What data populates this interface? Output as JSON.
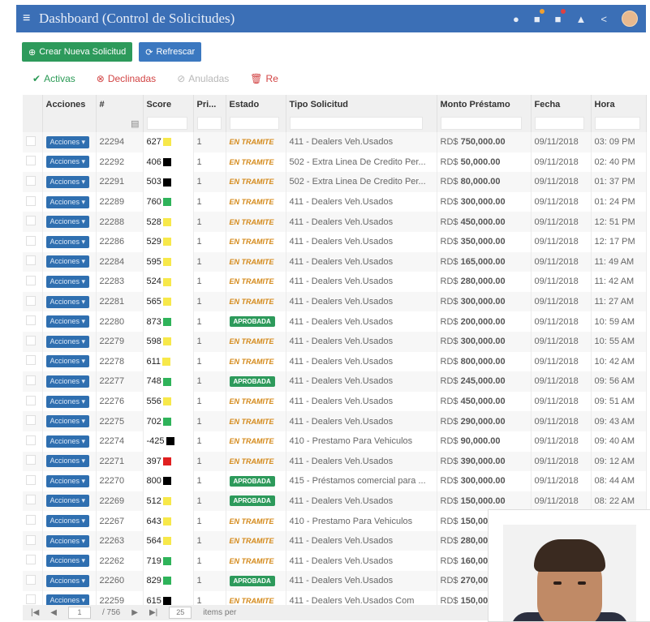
{
  "header": {
    "title": "Dashboard (Control de Solicitudes)"
  },
  "toolbar": {
    "create_label": "Crear Nueva Solicitud",
    "refresh_label": "Refrescar"
  },
  "filters": {
    "activas": "Activas",
    "declinadas": "Declinadas",
    "anuladas": "Anuladas",
    "re": "Re"
  },
  "columns": [
    "Acciones",
    "#",
    "Score",
    "Pri...",
    "Estado",
    "Tipo Solicitud",
    "Monto Préstamo",
    "Fecha",
    "Hora"
  ],
  "acciones_label": "Acciones ▾",
  "rows": [
    {
      "id": "22294",
      "score": "627",
      "color": "#f7e84a",
      "pri": "1",
      "estado": "EN TRAMITE",
      "tipo": "411 - Dealers Veh.Usados",
      "monto": "750,000.00",
      "fecha": "09/11/2018",
      "hora": "03: 09 PM"
    },
    {
      "id": "22292",
      "score": "406",
      "color": "#000000",
      "pri": "1",
      "estado": "EN TRAMITE",
      "tipo": "502 - Extra Linea De Credito Per...",
      "monto": "50,000.00",
      "fecha": "09/11/2018",
      "hora": "02: 40 PM"
    },
    {
      "id": "22291",
      "score": "503",
      "color": "#000000",
      "pri": "1",
      "estado": "EN TRAMITE",
      "tipo": "502 - Extra Linea De Credito Per...",
      "monto": "80,000.00",
      "fecha": "09/11/2018",
      "hora": "01: 37 PM"
    },
    {
      "id": "22289",
      "score": "760",
      "color": "#2fb35a",
      "pri": "1",
      "estado": "EN TRAMITE",
      "tipo": "411 - Dealers Veh.Usados",
      "monto": "300,000.00",
      "fecha": "09/11/2018",
      "hora": "01: 24 PM"
    },
    {
      "id": "22288",
      "score": "528",
      "color": "#f7e84a",
      "pri": "1",
      "estado": "EN TRAMITE",
      "tipo": "411 - Dealers Veh.Usados",
      "monto": "450,000.00",
      "fecha": "09/11/2018",
      "hora": "12: 51 PM"
    },
    {
      "id": "22286",
      "score": "529",
      "color": "#f7e84a",
      "pri": "1",
      "estado": "EN TRAMITE",
      "tipo": "411 - Dealers Veh.Usados",
      "monto": "350,000.00",
      "fecha": "09/11/2018",
      "hora": "12: 17 PM"
    },
    {
      "id": "22284",
      "score": "595",
      "color": "#f7e84a",
      "pri": "1",
      "estado": "EN TRAMITE",
      "tipo": "411 - Dealers Veh.Usados",
      "monto": "165,000.00",
      "fecha": "09/11/2018",
      "hora": "11: 49 AM"
    },
    {
      "id": "22283",
      "score": "524",
      "color": "#f7e84a",
      "pri": "1",
      "estado": "EN TRAMITE",
      "tipo": "411 - Dealers Veh.Usados",
      "monto": "280,000.00",
      "fecha": "09/11/2018",
      "hora": "11: 42 AM"
    },
    {
      "id": "22281",
      "score": "565",
      "color": "#f7e84a",
      "pri": "1",
      "estado": "EN TRAMITE",
      "tipo": "411 - Dealers Veh.Usados",
      "monto": "300,000.00",
      "fecha": "09/11/2018",
      "hora": "11: 27 AM"
    },
    {
      "id": "22280",
      "score": "873",
      "color": "#2fb35a",
      "pri": "1",
      "estado": "APROBADA",
      "tipo": "411 - Dealers Veh.Usados",
      "monto": "200,000.00",
      "fecha": "09/11/2018",
      "hora": "10: 59 AM"
    },
    {
      "id": "22279",
      "score": "598",
      "color": "#f7e84a",
      "pri": "1",
      "estado": "EN TRAMITE",
      "tipo": "411 - Dealers Veh.Usados",
      "monto": "300,000.00",
      "fecha": "09/11/2018",
      "hora": "10: 55 AM"
    },
    {
      "id": "22278",
      "score": "611",
      "color": "#f7e84a",
      "pri": "1",
      "estado": "EN TRAMITE",
      "tipo": "411 - Dealers Veh.Usados",
      "monto": "800,000.00",
      "fecha": "09/11/2018",
      "hora": "10: 42 AM"
    },
    {
      "id": "22277",
      "score": "748",
      "color": "#2fb35a",
      "pri": "1",
      "estado": "APROBADA",
      "tipo": "411 - Dealers Veh.Usados",
      "monto": "245,000.00",
      "fecha": "09/11/2018",
      "hora": "09: 56 AM"
    },
    {
      "id": "22276",
      "score": "556",
      "color": "#f7e84a",
      "pri": "1",
      "estado": "EN TRAMITE",
      "tipo": "411 - Dealers Veh.Usados",
      "monto": "450,000.00",
      "fecha": "09/11/2018",
      "hora": "09: 51 AM"
    },
    {
      "id": "22275",
      "score": "702",
      "color": "#2fb35a",
      "pri": "1",
      "estado": "EN TRAMITE",
      "tipo": "411 - Dealers Veh.Usados",
      "monto": "290,000.00",
      "fecha": "09/11/2018",
      "hora": "09: 43 AM"
    },
    {
      "id": "22274",
      "score": "-425",
      "color": "#000000",
      "pri": "1",
      "estado": "EN TRAMITE",
      "tipo": "410 - Prestamo Para Vehiculos",
      "monto": "90,000.00",
      "fecha": "09/11/2018",
      "hora": "09: 40 AM"
    },
    {
      "id": "22271",
      "score": "397",
      "color": "#e02020",
      "pri": "1",
      "estado": "EN TRAMITE",
      "tipo": "411 - Dealers Veh.Usados",
      "monto": "390,000.00",
      "fecha": "09/11/2018",
      "hora": "09: 12 AM"
    },
    {
      "id": "22270",
      "score": "800",
      "color": "#000000",
      "pri": "1",
      "estado": "APROBADA",
      "tipo": "415 - Préstamos comercial para ...",
      "monto": "300,000.00",
      "fecha": "09/11/2018",
      "hora": "08: 44 AM"
    },
    {
      "id": "22269",
      "score": "512",
      "color": "#f7e84a",
      "pri": "1",
      "estado": "APROBADA",
      "tipo": "411 - Dealers Veh.Usados",
      "monto": "150,000.00",
      "fecha": "09/11/2018",
      "hora": "08: 22 AM"
    },
    {
      "id": "22267",
      "score": "643",
      "color": "#f7e84a",
      "pri": "1",
      "estado": "EN TRAMITE",
      "tipo": "410 - Prestamo Para Vehiculos",
      "monto": "150,00",
      "fecha": "",
      "hora": ""
    },
    {
      "id": "22263",
      "score": "564",
      "color": "#f7e84a",
      "pri": "1",
      "estado": "EN TRAMITE",
      "tipo": "411 - Dealers Veh.Usados",
      "monto": "280,00",
      "fecha": "",
      "hora": ""
    },
    {
      "id": "22262",
      "score": "719",
      "color": "#2fb35a",
      "pri": "1",
      "estado": "EN TRAMITE",
      "tipo": "411 - Dealers Veh.Usados",
      "monto": "160,00",
      "fecha": "",
      "hora": ""
    },
    {
      "id": "22260",
      "score": "829",
      "color": "#2fb35a",
      "pri": "1",
      "estado": "APROBADA",
      "tipo": "411 - Dealers Veh.Usados",
      "monto": "270,00",
      "fecha": "",
      "hora": ""
    },
    {
      "id": "22259",
      "score": "615",
      "color": "#000000",
      "pri": "1",
      "estado": "EN TRAMITE",
      "tipo": "411 - Dealers Veh.Usados Com",
      "monto": "150,00",
      "fecha": "",
      "hora": ""
    }
  ],
  "currency_prefix": "RD$",
  "pager": {
    "page": "1",
    "of": "/ 756",
    "per_page": "25",
    "items_label": "items per"
  }
}
